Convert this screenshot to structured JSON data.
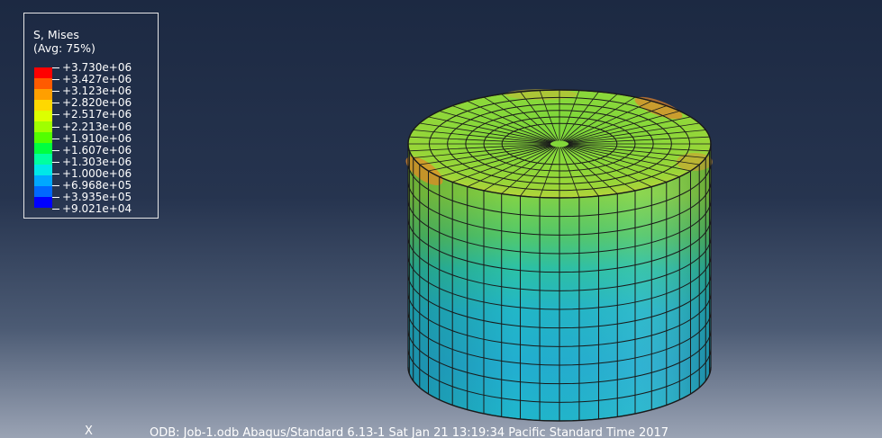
{
  "legend": {
    "title_line1": "S, Mises",
    "title_line2": "(Avg: 75%)",
    "values": [
      "+3.730e+06",
      "+3.427e+06",
      "+3.123e+06",
      "+2.820e+06",
      "+2.517e+06",
      "+2.213e+06",
      "+1.910e+06",
      "+1.607e+06",
      "+1.303e+06",
      "+1.000e+06",
      "+6.968e+05",
      "+3.935e+05",
      "+9.021e+04"
    ],
    "colors": [
      "#ff0000",
      "#ff5a00",
      "#ff9f00",
      "#ffd800",
      "#dcff00",
      "#9fff00",
      "#52ff00",
      "#00ff40",
      "#00ffa0",
      "#00e8e8",
      "#00a8ff",
      "#0068ff",
      "#0000ff"
    ]
  },
  "triad_label": "X",
  "status_line": "ODB: Job-1.odb    Abaqus/Standard 6.13-1    Sat Jan 21 13:19:34 Pacific Standard Time 2017"
}
